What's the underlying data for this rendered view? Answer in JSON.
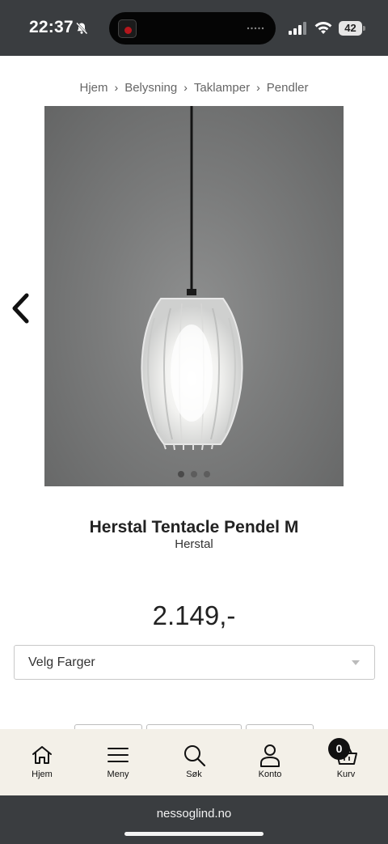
{
  "status_bar": {
    "time": "22:37",
    "battery_level": "42",
    "icons": [
      "bell-slash-icon",
      "signal-icon",
      "wifi-icon",
      "battery-icon"
    ]
  },
  "breadcrumb": {
    "items": [
      "Hjem",
      "Belysning",
      "Taklamper",
      "Pendler"
    ],
    "separator": "›"
  },
  "product": {
    "image_alt_icon": "pendant-lamp-image",
    "carousel_total": 3,
    "carousel_active": 1,
    "title": "Herstal Tentacle Pendel M",
    "brand": "Herstal",
    "price": "2.149,-",
    "color_select": {
      "selected": "Velg Farger"
    }
  },
  "bottom_nav": {
    "items": [
      {
        "label": "Hjem",
        "icon": "home-icon"
      },
      {
        "label": "Meny",
        "icon": "menu-icon"
      },
      {
        "label": "Søk",
        "icon": "search-icon"
      },
      {
        "label": "Konto",
        "icon": "account-icon"
      },
      {
        "label": "Kurv",
        "icon": "basket-icon"
      }
    ],
    "cart_count": "0"
  },
  "browser": {
    "url": "nessoglind.no"
  },
  "colors": {
    "status_bar_bg": "#3a3d40",
    "nav_bg": "#f3f0e8",
    "badge_bg": "#111111"
  }
}
